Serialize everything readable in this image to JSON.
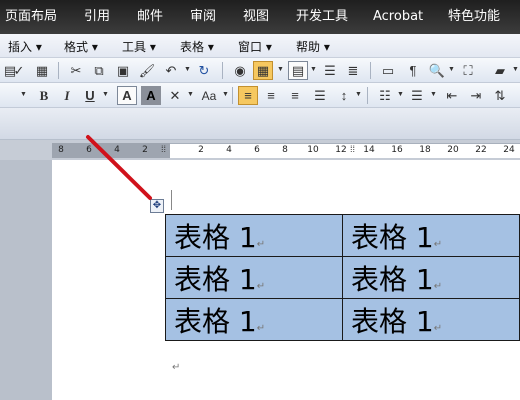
{
  "ribbon_tabs": [
    "页面布局",
    "引用",
    "邮件",
    "审阅",
    "视图",
    "开发工具",
    "Acrobat",
    "特色功能"
  ],
  "menu": [
    "插入 ▾",
    "格式 ▾",
    "工具 ▾",
    "表格 ▾",
    "窗口 ▾",
    "帮助 ▾"
  ],
  "format_toolbar": {
    "bold": "B",
    "italic": "I",
    "underline": "U",
    "char_border": "A",
    "char_shading": "A",
    "change_case": "Aa"
  },
  "ruler_numbers": [
    "8",
    "6",
    "4",
    "2",
    "2",
    "4",
    "6",
    "8",
    "10",
    "12",
    "14",
    "16",
    "18",
    "20",
    "22",
    "24"
  ],
  "table": {
    "rows": [
      [
        "表格 1",
        "表格 1"
      ],
      [
        "表格 1",
        "表格 1"
      ],
      [
        "表格 1",
        "表格 1"
      ]
    ],
    "cell_mark": "↵",
    "highlight_color": "#a5c1e3"
  },
  "paragraph_mark": "↵",
  "table_handle_glyph": "✥",
  "annotation_arrow_color": "#d0121b"
}
